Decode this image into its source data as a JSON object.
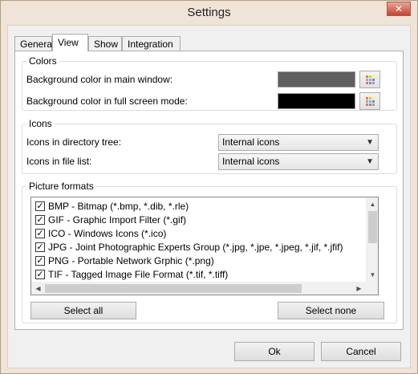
{
  "window": {
    "title": "Settings"
  },
  "tabs": [
    {
      "label": "General"
    },
    {
      "label": "View"
    },
    {
      "label": "Show"
    },
    {
      "label": "Integration"
    }
  ],
  "colors": {
    "legend": "Colors",
    "main_window_label": "Background color in main window:",
    "main_window_color": "#5f5f5f",
    "fullscreen_label": "Background color in full screen mode:",
    "fullscreen_color": "#000000",
    "palette_icon": "color-palette-icon"
  },
  "icons": {
    "legend": "Icons",
    "directory_tree_label": "Icons in directory tree:",
    "directory_tree_value": "Internal icons",
    "file_list_label": "Icons in file list:",
    "file_list_value": "Internal icons"
  },
  "picture_formats": {
    "legend": "Picture formats",
    "items": [
      {
        "label": "BMP - Bitmap (*.bmp, *.dib, *.rle)",
        "checked": true
      },
      {
        "label": "GIF - Graphic Import Filter (*.gif)",
        "checked": true
      },
      {
        "label": "ICO - Windows Icons (*.ico)",
        "checked": true
      },
      {
        "label": "JPG - Joint Photographic Experts Group (*.jpg, *.jpe, *.jpeg, *.jif, *.jfif)",
        "checked": true
      },
      {
        "label": "PNG - Portable Network Grphic (*.png)",
        "checked": true
      },
      {
        "label": "TIF - Tagged Image File Format (*.tif, *.tiff)",
        "checked": true
      }
    ],
    "select_all": "Select all",
    "select_none": "Select none"
  },
  "footer": {
    "ok": "Ok",
    "cancel": "Cancel"
  }
}
